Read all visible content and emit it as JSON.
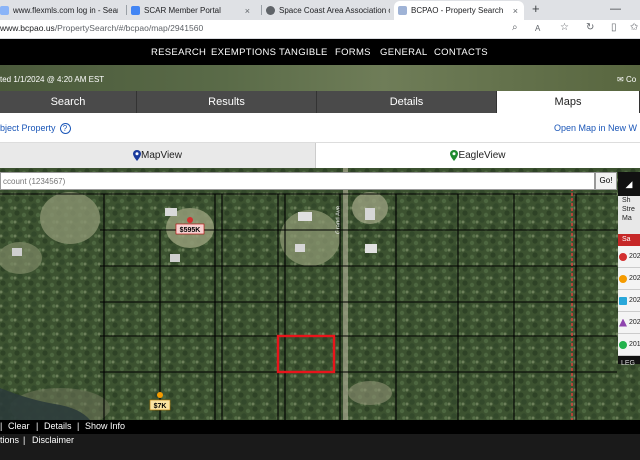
{
  "browser": {
    "tabs": [
      {
        "label": "www.flexmls.com log in - Search"
      },
      {
        "label": "SCAR Member Portal"
      },
      {
        "label": "Space Coast Area Association of"
      },
      {
        "label": "BCPAO - Property Search"
      }
    ],
    "new_tab": "+",
    "close": "×",
    "url_host": "www.bcpao.us",
    "url_path": "/PropertySearch/#/bcpao/map/2941560"
  },
  "nav": {
    "items": [
      "RESEARCH",
      "EXEMPTIONS",
      "TANGIBLE",
      "FORMS",
      "GENERAL",
      "CONTACTS"
    ]
  },
  "banner": {
    "updated": "ted 1/1/2024 @ 4:20 AM EST",
    "contact": "Co"
  },
  "section_tabs": [
    "Search",
    "Results",
    "Details",
    "Maps"
  ],
  "subject": {
    "label": "bject Property",
    "help": "?",
    "open_map": "Open Map in New W"
  },
  "views": {
    "map_view": "MapView",
    "eagle_view": "EagleView"
  },
  "map": {
    "search_placeholder": "ccount (1234567)",
    "go": "Go!",
    "price_tags": [
      "$595K",
      "$7K"
    ],
    "road_label": "Grand Ave"
  },
  "legend": {
    "header": "◢",
    "text": "Sh Stre Ma",
    "sales_label": "Sa",
    "years": [
      "202",
      "202",
      "202",
      "202",
      "201"
    ],
    "year_colors": [
      "#d32f2f",
      "#f59b00",
      "#29a7d9",
      "#8e44ad",
      "#22b24c"
    ],
    "footer": "LEG"
  },
  "map_tools": [
    "Clear",
    "Details",
    "Show Info"
  ],
  "footer": [
    "tions",
    "Disclaimer"
  ]
}
